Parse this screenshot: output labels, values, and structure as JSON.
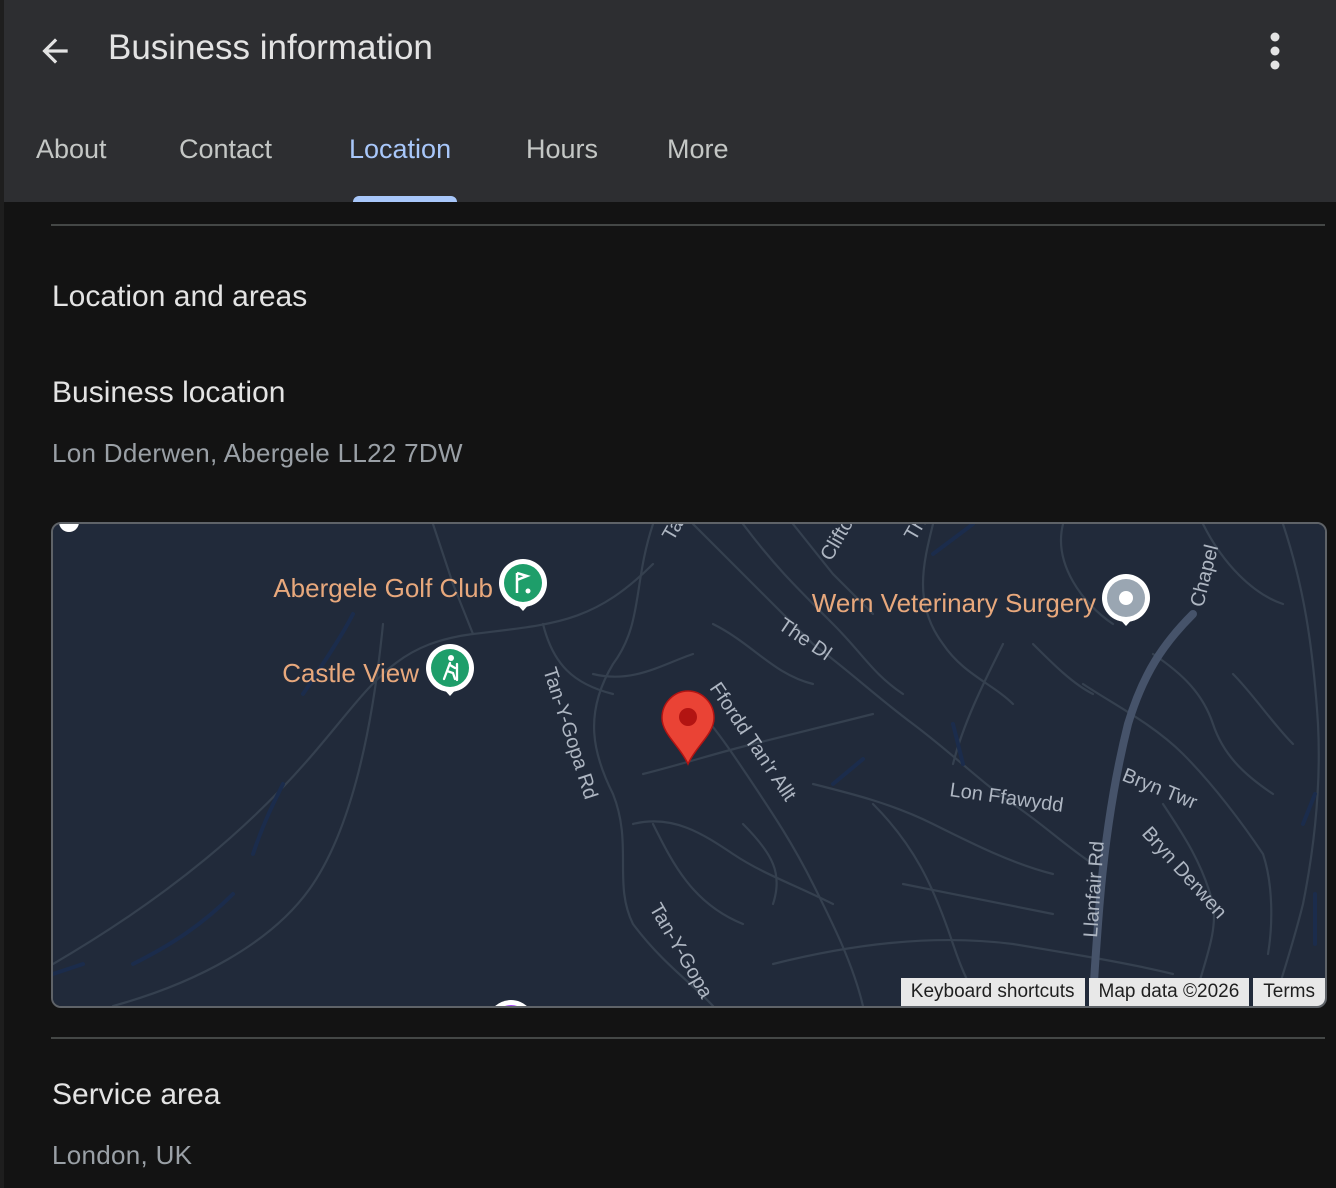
{
  "header": {
    "title": "Business information",
    "tabs": [
      {
        "label": "About"
      },
      {
        "label": "Contact"
      },
      {
        "label": "Location"
      },
      {
        "label": "Hours"
      },
      {
        "label": "More"
      }
    ],
    "active_tab": "Location"
  },
  "section": {
    "title": "Location and areas",
    "business_location": {
      "label": "Business location",
      "value": "Lon Dderwen, Abergele LL22 7DW"
    },
    "service_area": {
      "label": "Service area",
      "value": "London, UK"
    }
  },
  "map": {
    "places": [
      {
        "name": "Abergele Golf Club",
        "icon": "golf-icon"
      },
      {
        "name": "Castle View",
        "icon": "hiking-icon"
      },
      {
        "name": "Wern Veterinary Surgery",
        "icon": "place-pin-icon"
      }
    ],
    "roads": [
      "Tan-Y-Gopa Rd",
      "Ffordd Tan'r Allt",
      "The Dl",
      "Lon Ffawydd",
      "Llanfair Rd",
      "Bryn Twr",
      "Bryn Derwen",
      "Chapel",
      "Tan-Y-Gopa",
      "Clifto",
      "Tan",
      "Th"
    ],
    "footer": {
      "shortcuts": "Keyboard shortcuts",
      "data": "Map data ©2026",
      "terms": "Terms"
    }
  },
  "colors": {
    "accent": "#a8c7fa",
    "header_bg": "#2d2e31",
    "page_bg": "#131313",
    "place_label": "#e8a87c",
    "pin_red": "#ea4335",
    "poi_green": "#1e9e6a"
  }
}
